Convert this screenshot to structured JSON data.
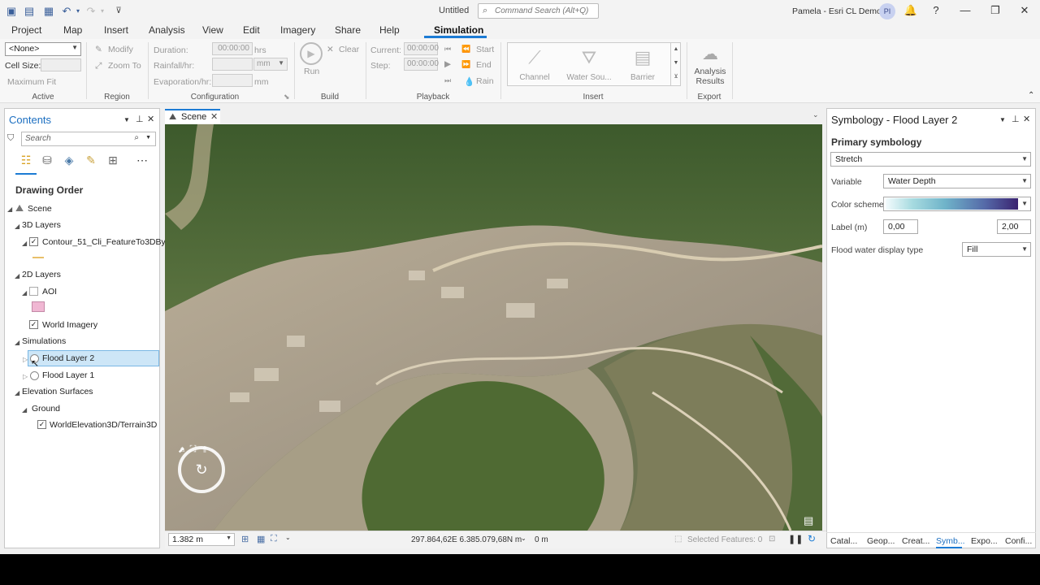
{
  "window": {
    "title": "Untitled",
    "command_search_placeholder": "Command Search (Alt+Q)",
    "user": "Pamela - Esri CL Demo",
    "avatar_initials": "PI"
  },
  "ribbon_tabs": [
    "Project",
    "Map",
    "Insert",
    "Analysis",
    "View",
    "Edit",
    "Imagery",
    "Share",
    "Help",
    "Simulation"
  ],
  "ribbon": {
    "active": {
      "dropdown_value": "<None>",
      "cell_size_label": "Cell Size:",
      "maximum_fit_label": "Maximum Fit",
      "group_label": "Active"
    },
    "region": {
      "modify_label": "Modify",
      "zoom_to_label": "Zoom To",
      "group_label": "Region"
    },
    "configuration": {
      "duration_label": "Duration:",
      "duration_value": "00:00:00",
      "duration_unit": "hrs",
      "rainfall_label": "Rainfall/hr:",
      "rainfall_unit": "mm",
      "evaporation_label": "Evaporation/hr:",
      "evaporation_unit": "mm",
      "group_label": "Configuration"
    },
    "build": {
      "run_label": "Run",
      "clear_label": "Clear",
      "group_label": "Build"
    },
    "playback": {
      "current_label": "Current:",
      "current_value": "00:00:00",
      "step_label": "Step:",
      "step_value": "00:00:00",
      "start_label": "Start",
      "end_label": "End",
      "rain_label": "Rain",
      "group_label": "Playback"
    },
    "insert": {
      "items": [
        "Channel",
        "Water Sou...",
        "Barrier"
      ],
      "group_label": "Insert"
    },
    "export": {
      "analysis_results_line1": "Analysis",
      "analysis_results_line2": "Results",
      "group_label": "Export"
    }
  },
  "contents": {
    "title": "Contents",
    "search_placeholder": "Search",
    "drawing_order_label": "Drawing Order",
    "tree": {
      "scene": "Scene",
      "layers_3d": "3D Layers",
      "contour": "Contour_51_Cli_FeatureTo3DBy",
      "layers_2d": "2D Layers",
      "aoi": "AOI",
      "world_imagery": "World Imagery",
      "simulations": "Simulations",
      "flood_layer_2": "Flood Layer 2",
      "flood_layer_1": "Flood Layer 1",
      "elevation_surfaces": "Elevation Surfaces",
      "ground": "Ground",
      "terrain": "WorldElevation3D/Terrain3D"
    },
    "colors": {
      "aoi_swatch": "#f0b7d3",
      "contour_line": "#e8c06a"
    }
  },
  "scene": {
    "tab_label": "Scene",
    "scale": "1.382 m",
    "coordinates": "297.864,62E 6.385.079,68N m",
    "elevation": "0 m",
    "selected_features": "Selected Features: 0"
  },
  "symbology": {
    "title": "Symbology - Flood Layer 2",
    "primary_label": "Primary symbology",
    "renderer": "Stretch",
    "variable_label": "Variable",
    "variable_value": "Water Depth",
    "color_scheme_label": "Color scheme",
    "label_caption": "Label (m)",
    "label_min": "0,00",
    "label_max": "2,00",
    "display_type_label": "Flood water display type",
    "display_type_value": "Fill",
    "bottom_tabs": [
      "Catal...",
      "Geop...",
      "Creat...",
      "Symb...",
      "Expo...",
      "Confi..."
    ]
  }
}
